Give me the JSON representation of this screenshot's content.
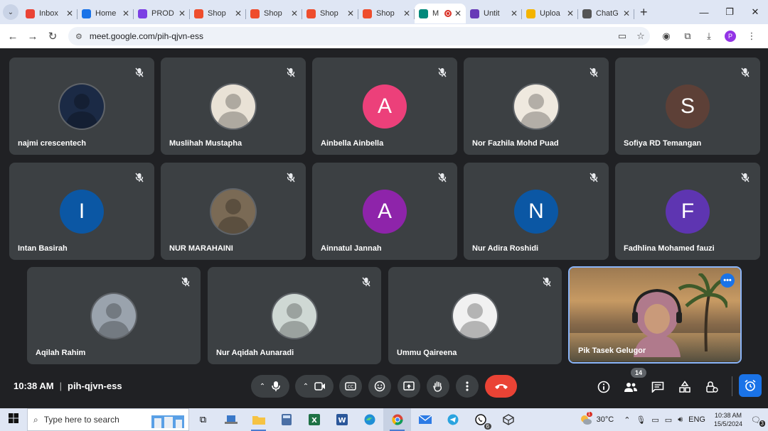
{
  "browser": {
    "tabs": [
      {
        "label": "Inbox",
        "icon": "gmail-icon",
        "color": "#ea4335",
        "active": false
      },
      {
        "label": "Home",
        "icon": "chrome-icon",
        "color": "#1a73e8",
        "active": false
      },
      {
        "label": "PROD",
        "icon": "canva-icon",
        "color": "#7b3fe4",
        "active": false
      },
      {
        "label": "Shop",
        "icon": "shopee-icon",
        "color": "#ee4d2d",
        "active": false
      },
      {
        "label": "Shop",
        "icon": "shopee-icon",
        "color": "#ee4d2d",
        "active": false
      },
      {
        "label": "Shop",
        "icon": "shopee-icon",
        "color": "#ee4d2d",
        "active": false
      },
      {
        "label": "Shop",
        "icon": "shopee-icon",
        "color": "#ee4d2d",
        "active": false
      },
      {
        "label": "M",
        "icon": "meet-icon",
        "color": "#00897b",
        "active": true
      },
      {
        "label": "Untit",
        "icon": "forms-icon",
        "color": "#673ab7",
        "active": false
      },
      {
        "label": "Uploa",
        "icon": "upload-icon",
        "color": "#f4b400",
        "active": false
      },
      {
        "label": "ChatG",
        "icon": "chatgpt-icon",
        "color": "#555555",
        "active": false
      }
    ],
    "url": "meet.google.com/pih-qjvn-ess",
    "profile_initial": "P"
  },
  "participants": [
    {
      "name": "najmi crescentech",
      "initial": "",
      "bg": "#1b2a45",
      "photo": true
    },
    {
      "name": "Muslihah Mustapha",
      "initial": "",
      "bg": "#e9e2d6",
      "photo": true
    },
    {
      "name": "Ainbella Ainbella",
      "initial": "A",
      "bg": "#ec407a",
      "photo": false
    },
    {
      "name": "Nor Fazhila Mohd Puad",
      "initial": "",
      "bg": "#efe9df",
      "photo": true
    },
    {
      "name": "Sofiya RD Temangan",
      "initial": "S",
      "bg": "#5d4037",
      "photo": false
    },
    {
      "name": "Intan Basirah",
      "initial": "I",
      "bg": "#0b57a4",
      "photo": false
    },
    {
      "name": "NUR MARAHAINI",
      "initial": "",
      "bg": "#7a6a55",
      "photo": true
    },
    {
      "name": "Ainnatul Jannah",
      "initial": "A",
      "bg": "#8e24aa",
      "photo": false
    },
    {
      "name": "Nur Adira Roshidi",
      "initial": "N",
      "bg": "#0b57a4",
      "photo": false
    },
    {
      "name": "Fadhlina Mohamed fauzi",
      "initial": "F",
      "bg": "#5e35b1",
      "photo": false
    },
    {
      "name": "Aqilah Rahim",
      "initial": "",
      "bg": "#9aa3ad",
      "photo": true
    },
    {
      "name": "Nur Aqidah Aunaradi",
      "initial": "",
      "bg": "#cfd8d4",
      "photo": true
    },
    {
      "name": "Ummu Qaireena",
      "initial": "",
      "bg": "#f1f1f1",
      "photo": true
    }
  ],
  "self_view": {
    "name": "Pik Tasek Gelugor"
  },
  "controls": {
    "time": "10:38 AM",
    "meeting_code": "pih-qjvn-ess",
    "participant_count": "14"
  },
  "taskbar": {
    "search_placeholder": "Type here to search",
    "whatsapp_badge": "6",
    "weather_badge": "1",
    "temperature": "30°C",
    "language": "ENG",
    "clock_time": "10:38 AM",
    "clock_date": "15/5/2024",
    "notifications": "3"
  }
}
